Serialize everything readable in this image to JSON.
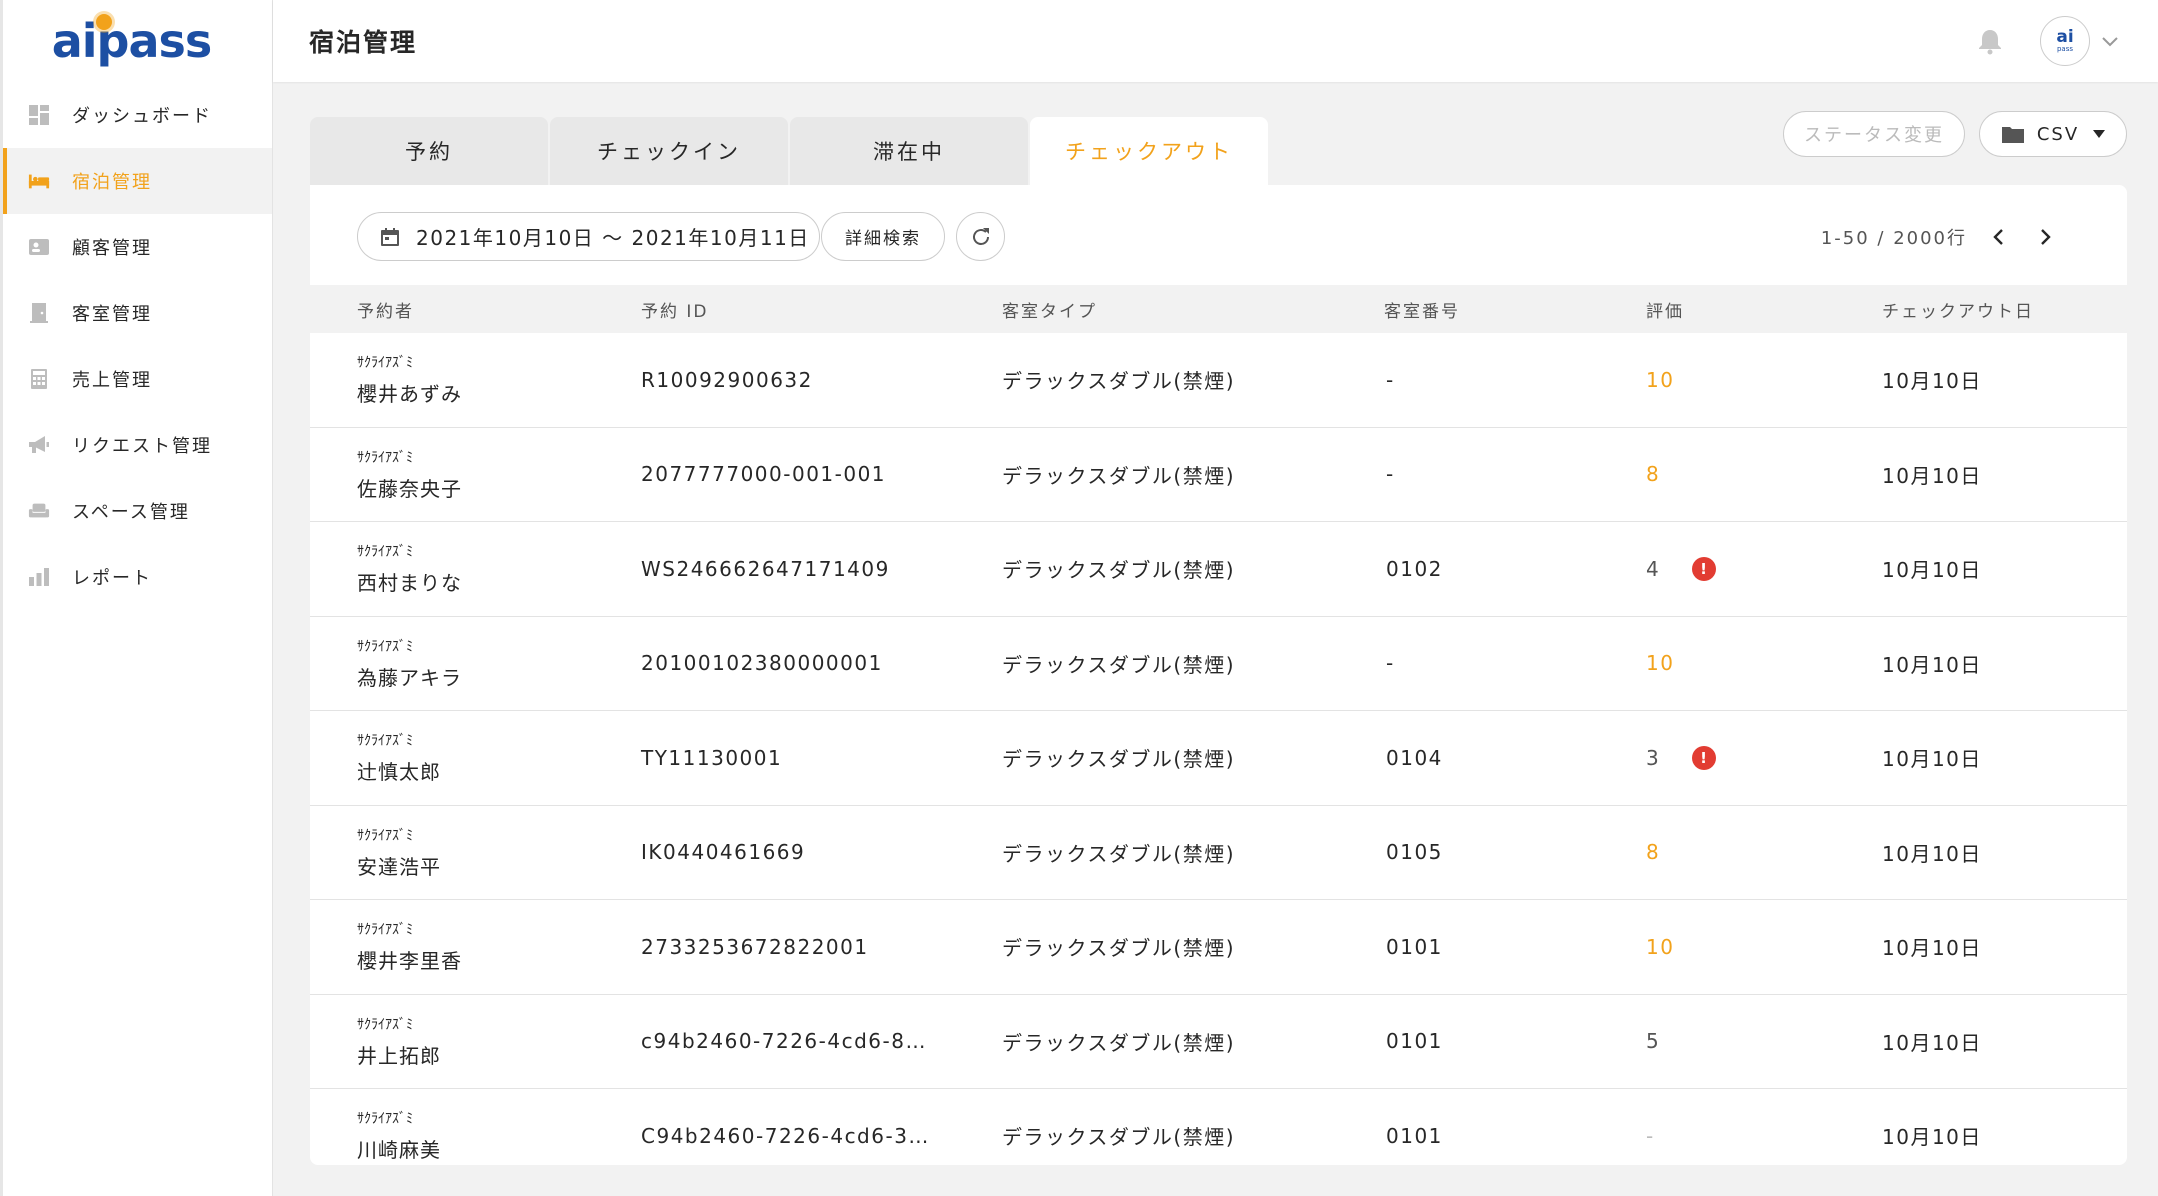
{
  "brand": {
    "logo_text": "aipass",
    "accent": "#f2a21b",
    "brand_blue": "#1d4fa3"
  },
  "sidebar": {
    "items": [
      {
        "label": "ダッシュボード",
        "icon": "dashboard-icon"
      },
      {
        "label": "宿泊管理",
        "icon": "bed-icon",
        "active": true
      },
      {
        "label": "顧客管理",
        "icon": "id-card-icon"
      },
      {
        "label": "客室管理",
        "icon": "door-icon"
      },
      {
        "label": "売上管理",
        "icon": "calculator-icon"
      },
      {
        "label": "リクエスト管理",
        "icon": "megaphone-icon"
      },
      {
        "label": "スペース管理",
        "icon": "sofa-icon"
      },
      {
        "label": "レポート",
        "icon": "bar-chart-icon"
      }
    ]
  },
  "header": {
    "title": "宿泊管理",
    "avatar_text": "ai",
    "avatar_sub": "pass"
  },
  "tabs": [
    {
      "label": "予約"
    },
    {
      "label": "チェックイン"
    },
    {
      "label": "滞在中"
    },
    {
      "label": "チェックアウト",
      "active": true
    }
  ],
  "actions": {
    "status_change": "ステータス変更",
    "csv": "CSV"
  },
  "toolbar": {
    "date_range": "2021年10月10日 ～ 2021年10月11日",
    "detail_search": "詳細検索",
    "pagination": "1-50 / 2000行"
  },
  "table": {
    "columns": [
      "予約者",
      "予約 ID",
      "客室タイプ",
      "客室番号",
      "評価",
      "チェックアウト日"
    ],
    "rows": [
      {
        "kana": "ｻｸﾗｲｱｽﾞﾐ",
        "name": "櫻井あずみ",
        "id": "R10092900632",
        "room_type": "デラックスダブル(禁煙)",
        "room_no": "-",
        "rating": "10",
        "rating_level": "high",
        "alert": false,
        "checkout": "10月10日"
      },
      {
        "kana": "ｻｸﾗｲｱｽﾞﾐ",
        "name": "佐藤奈央子",
        "id": "2077777000-001-001",
        "room_type": "デラックスダブル(禁煙)",
        "room_no": "-",
        "rating": "8",
        "rating_level": "high",
        "alert": false,
        "checkout": "10月10日"
      },
      {
        "kana": "ｻｸﾗｲｱｽﾞﾐ",
        "name": "西村まりな",
        "id": "WS246662647171409",
        "room_type": "デラックスダブル(禁煙)",
        "room_no": "0102",
        "rating": "4",
        "rating_level": "low",
        "alert": true,
        "checkout": "10月10日"
      },
      {
        "kana": "ｻｸﾗｲｱｽﾞﾐ",
        "name": "為藤アキラ",
        "id": "20100102380000001",
        "room_type": "デラックスダブル(禁煙)",
        "room_no": "-",
        "rating": "10",
        "rating_level": "high",
        "alert": false,
        "checkout": "10月10日"
      },
      {
        "kana": "ｻｸﾗｲｱｽﾞﾐ",
        "name": "辻慎太郎",
        "id": "TY11130001",
        "room_type": "デラックスダブル(禁煙)",
        "room_no": "0104",
        "rating": "3",
        "rating_level": "low",
        "alert": true,
        "checkout": "10月10日"
      },
      {
        "kana": "ｻｸﾗｲｱｽﾞﾐ",
        "name": "安達浩平",
        "id": "IK0440461669",
        "room_type": "デラックスダブル(禁煙)",
        "room_no": "0105",
        "rating": "8",
        "rating_level": "high",
        "alert": false,
        "checkout": "10月10日"
      },
      {
        "kana": "ｻｸﾗｲｱｽﾞﾐ",
        "name": "櫻井李里香",
        "id": "2733253672822001",
        "room_type": "デラックスダブル(禁煙)",
        "room_no": "0101",
        "rating": "10",
        "rating_level": "high",
        "alert": false,
        "checkout": "10月10日"
      },
      {
        "kana": "ｻｸﾗｲｱｽﾞﾐ",
        "name": "井上拓郎",
        "id": "c94b2460-7226-4cd6-8…",
        "room_type": "デラックスダブル(禁煙)",
        "room_no": "0101",
        "rating": "5",
        "rating_level": "low",
        "alert": false,
        "checkout": "10月10日"
      },
      {
        "kana": "ｻｸﾗｲｱｽﾞﾐ",
        "name": "川崎麻美",
        "id": "C94b2460-7226-4cd6-3…",
        "room_type": "デラックスダブル(禁煙)",
        "room_no": "0101",
        "rating": "-",
        "rating_level": "none",
        "alert": false,
        "checkout": "10月10日"
      }
    ]
  }
}
